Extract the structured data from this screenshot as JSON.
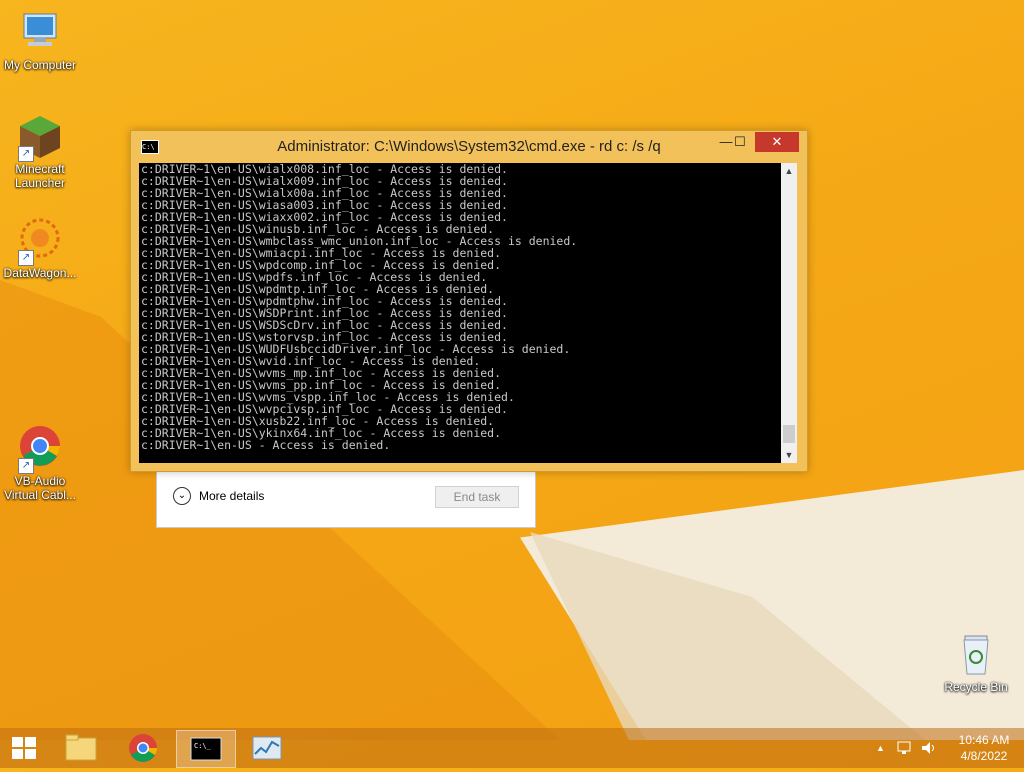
{
  "desktop": {
    "icons": [
      {
        "label": "My Computer"
      },
      {
        "label": "Minecraft Launcher"
      },
      {
        "label": "DataWagon..."
      },
      {
        "label": "VB-Audio Virtual Cabl..."
      },
      {
        "label": "Recycle Bin"
      }
    ]
  },
  "task_manager": {
    "more_details": "More details",
    "end_task": "End task"
  },
  "cmd": {
    "title": "Administrator: C:\\Windows\\System32\\cmd.exe - rd  c: /s /q",
    "lines": [
      "c:DRIVER~1\\en-US\\wialx008.inf_loc - Access is denied.",
      "c:DRIVER~1\\en-US\\wialx009.inf_loc - Access is denied.",
      "c:DRIVER~1\\en-US\\wialx00a.inf_loc - Access is denied.",
      "c:DRIVER~1\\en-US\\wiasa003.inf_loc - Access is denied.",
      "c:DRIVER~1\\en-US\\wiaxx002.inf_loc - Access is denied.",
      "c:DRIVER~1\\en-US\\winusb.inf_loc - Access is denied.",
      "c:DRIVER~1\\en-US\\wmbclass_wmc_union.inf_loc - Access is denied.",
      "c:DRIVER~1\\en-US\\wmiacpi.inf_loc - Access is denied.",
      "c:DRIVER~1\\en-US\\wpdcomp.inf_loc - Access is denied.",
      "c:DRIVER~1\\en-US\\wpdfs.inf_loc - Access is denied.",
      "c:DRIVER~1\\en-US\\wpdmtp.inf_loc - Access is denied.",
      "c:DRIVER~1\\en-US\\wpdmtphw.inf_loc - Access is denied.",
      "c:DRIVER~1\\en-US\\WSDPrint.inf_loc - Access is denied.",
      "c:DRIVER~1\\en-US\\WSDScDrv.inf_loc - Access is denied.",
      "c:DRIVER~1\\en-US\\wstorvsp.inf_loc - Access is denied.",
      "c:DRIVER~1\\en-US\\WUDFUsbccidDriver.inf_loc - Access is denied.",
      "c:DRIVER~1\\en-US\\wvid.inf_loc - Access is denied.",
      "c:DRIVER~1\\en-US\\wvms_mp.inf_loc - Access is denied.",
      "c:DRIVER~1\\en-US\\wvms_pp.inf_loc - Access is denied.",
      "c:DRIVER~1\\en-US\\wvms_vspp.inf_loc - Access is denied.",
      "c:DRIVER~1\\en-US\\wvpcivsp.inf_loc - Access is denied.",
      "c:DRIVER~1\\en-US\\xusb22.inf_loc - Access is denied.",
      "c:DRIVER~1\\en-US\\ykinx64.inf_loc - Access is denied.",
      "c:DRIVER~1\\en-US - Access is denied."
    ]
  },
  "taskbar": {
    "clock_time": "10:46 AM",
    "clock_date": "4/8/2022"
  }
}
